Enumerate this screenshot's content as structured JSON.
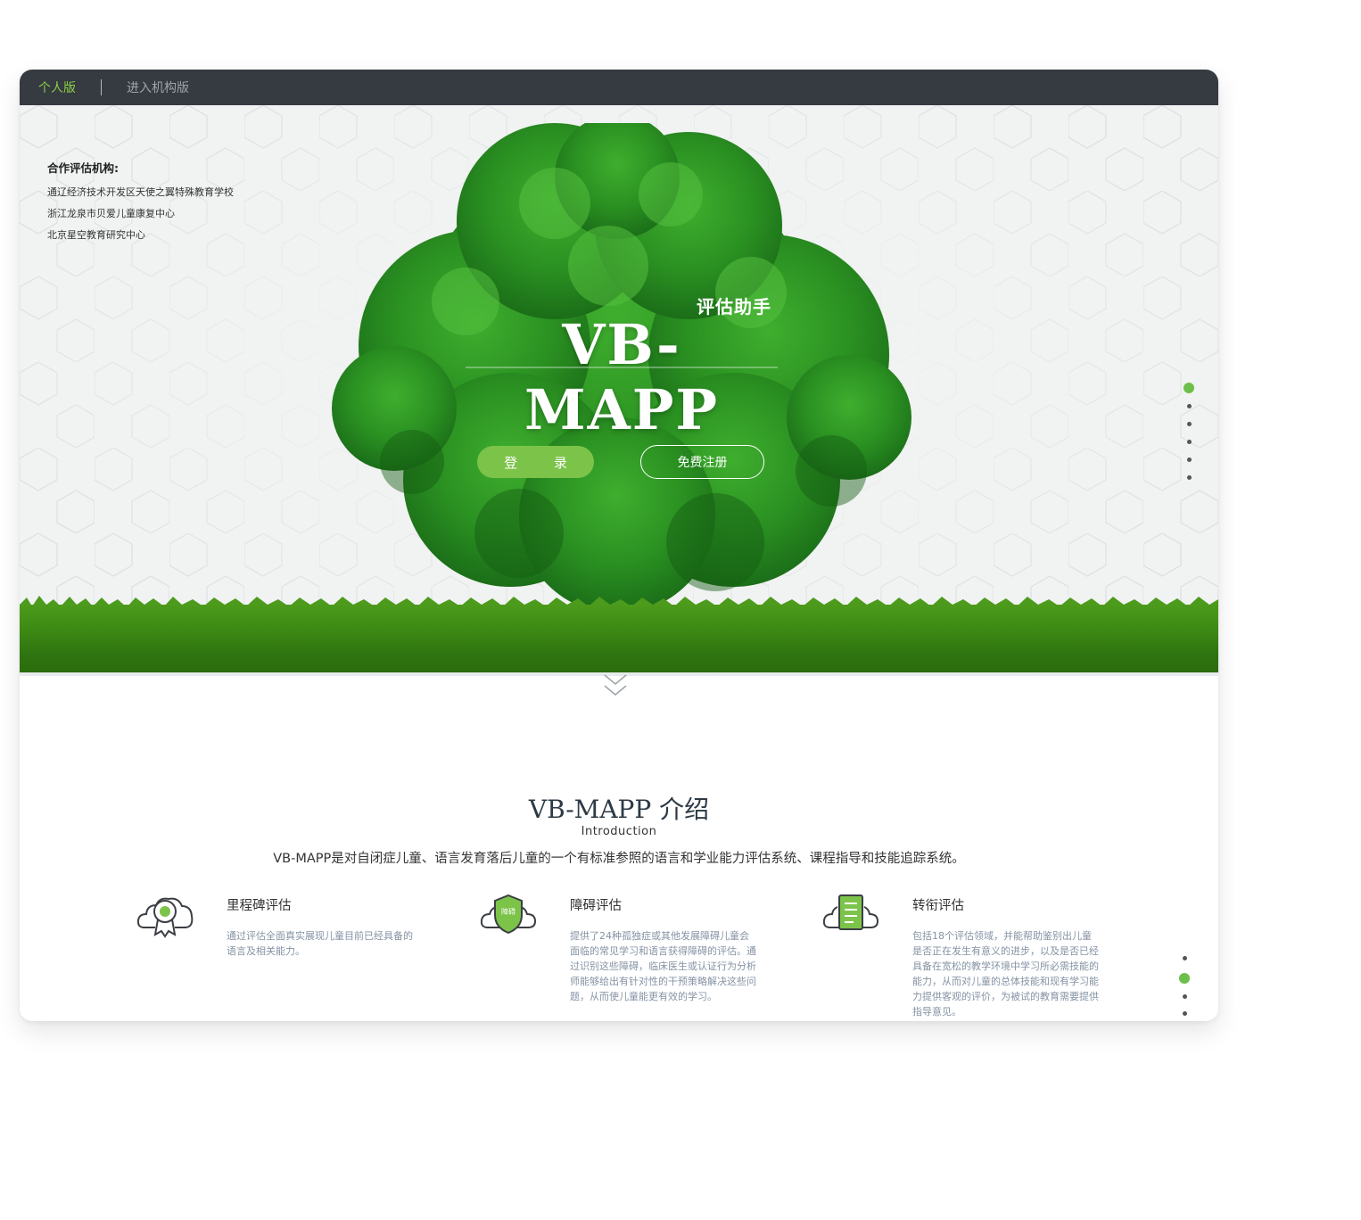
{
  "topbar": {
    "tabs": [
      {
        "label": "个人版",
        "active": true
      },
      {
        "label": "进入机构版",
        "active": false
      }
    ]
  },
  "partners": {
    "title": "合作评估机构:",
    "items": [
      "通辽经济技术开发区天使之翼特殊教育学校",
      "浙江龙泉市贝爱儿童康复中心",
      "北京星空教育研究中心"
    ]
  },
  "hero": {
    "subtitle": "评估助手",
    "title": "VB-MAPP",
    "login_label": "登 录",
    "register_label": "免费注册"
  },
  "intro": {
    "title": "VB-MAPP 介绍",
    "subtitle_en": "Introduction",
    "description": "VB-MAPP是对自闭症儿童、语言发育落后儿童的一个有标准参照的语言和学业能力评估系统、课程指导和技能追踪系统。",
    "features": [
      {
        "title": "里程碑评估",
        "icon": "award-ribbon-cloud-icon",
        "lines": [
          "通过评估全面真实展现儿童目前已经具备的",
          "语言及相关能力。"
        ]
      },
      {
        "title": "障碍评估",
        "icon": "shield-cloud-icon",
        "badge_text": "障碍",
        "lines": [
          "提供了24种孤独症或其他发展障碍儿童会",
          "面临的常见学习和语言获得障碍的评估。通",
          "过识别这些障碍，临床医生或认证行为分析",
          "师能够给出有针对性的干预策略解决这些问",
          "题，从而使儿童能更有效的学习。"
        ]
      },
      {
        "title": "转衔评估",
        "icon": "document-cloud-icon",
        "lines": [
          "包括18个评估领域，并能帮助鉴别出儿童",
          "是否正在发生有意义的进步，以及是否已经",
          "具备在宽松的教学环境中学习所必需技能的",
          "能力，从而对儿童的总体技能和现有学习能",
          "力提供客观的评价，为被试的教育需要提供",
          "指导意见。"
        ]
      }
    ]
  },
  "colors": {
    "topbar": "#353b40",
    "accent_green": "#7cc34a",
    "active_tab": "#8ccc4a"
  },
  "pagination": {
    "hero_active_index": 0,
    "hero_count": 6,
    "intro_active_index": 1,
    "intro_count": 4
  }
}
